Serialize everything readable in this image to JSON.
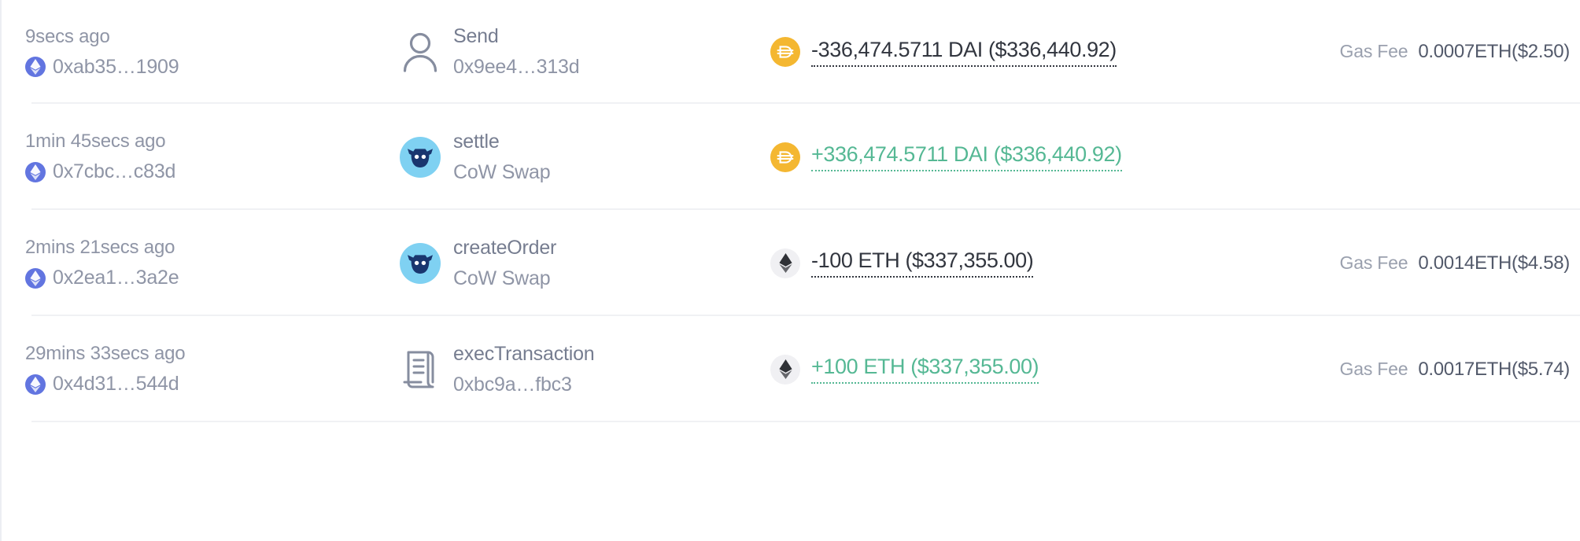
{
  "table": {
    "gas_fee_label": "Gas Fee",
    "rows": [
      {
        "time": "9secs ago",
        "chain_icon": "ethereum-chain-icon",
        "tx_hash": "0xab35…1909",
        "action_icon": "person-icon",
        "action_name": "Send",
        "action_sub": "0x9ee4…313d",
        "token_icon": "dai-token-icon",
        "token": "dai",
        "amount": "-336,474.5711 DAI ($336,440.92)",
        "amount_sign": "negative",
        "gas_fee_label": "Gas Fee",
        "gas_fee": "0.0007ETH($2.50)",
        "has_gas_fee": true
      },
      {
        "time": "1min 45secs ago",
        "chain_icon": "ethereum-chain-icon",
        "tx_hash": "0x7cbc…c83d",
        "action_icon": "cow-swap-icon",
        "action_name": "settle",
        "action_sub": "CoW Swap",
        "token_icon": "dai-token-icon",
        "token": "dai",
        "amount": "+336,474.5711 DAI ($336,440.92)",
        "amount_sign": "positive",
        "gas_fee_label": "Gas Fee",
        "gas_fee": "",
        "has_gas_fee": false
      },
      {
        "time": "2mins 21secs ago",
        "chain_icon": "ethereum-chain-icon",
        "tx_hash": "0x2ea1…3a2e",
        "action_icon": "cow-swap-icon",
        "action_name": "createOrder",
        "action_sub": "CoW Swap",
        "token_icon": "eth-token-icon",
        "token": "eth",
        "amount": "-100 ETH ($337,355.00)",
        "amount_sign": "negative",
        "gas_fee_label": "Gas Fee",
        "gas_fee": "0.0014ETH($4.58)",
        "has_gas_fee": true
      },
      {
        "time": "29mins 33secs ago",
        "chain_icon": "ethereum-chain-icon",
        "tx_hash": "0x4d31…544d",
        "action_icon": "contract-scroll-icon",
        "action_name": "execTransaction",
        "action_sub": "0xbc9a…fbc3",
        "token_icon": "eth-token-icon",
        "token": "eth",
        "amount": "+100 ETH ($337,355.00)",
        "amount_sign": "positive",
        "gas_fee_label": "Gas Fee",
        "gas_fee": "0.0017ETH($5.74)",
        "has_gas_fee": true
      }
    ]
  },
  "colors": {
    "positive_amount": "#55b894",
    "negative_amount": "#32363f",
    "muted_text": "#8f95a6",
    "chain_badge": "#6275e0",
    "dai_token": "#f4b731",
    "eth_token_bg": "#f0f0f3",
    "cow_circle": "#7fd1f2",
    "cow_head": "#19366f",
    "divider": "#f0f1f4"
  }
}
